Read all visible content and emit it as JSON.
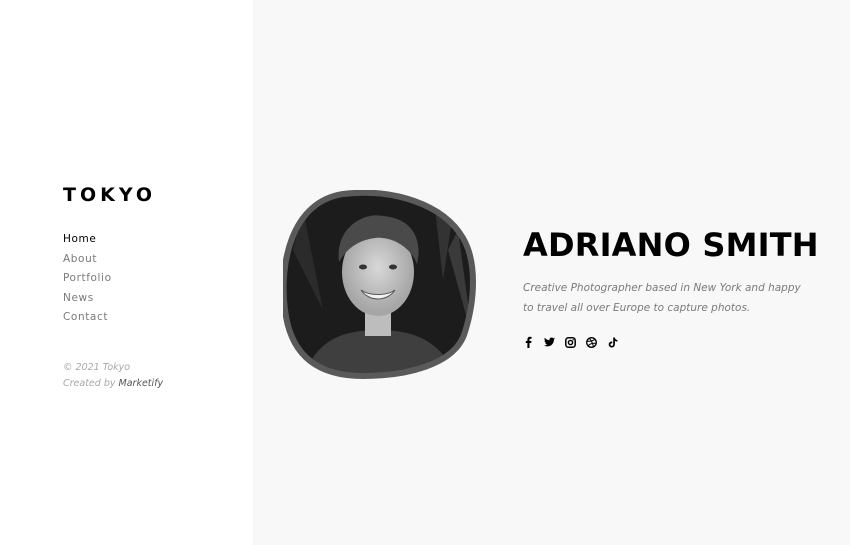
{
  "sidebar": {
    "logo": "TOKYO",
    "nav": [
      {
        "label": "Home",
        "active": true
      },
      {
        "label": "About"
      },
      {
        "label": "Portfolio"
      },
      {
        "label": "News"
      },
      {
        "label": "Contact"
      }
    ],
    "copyright": "© 2021 Tokyo",
    "created_by": "Created by",
    "brand": "Marketify"
  },
  "hero": {
    "name": "ADRIANO SMITH",
    "bio_line1": "Creative Photographer based in New York and happy",
    "bio_line2": "to travel all over Europe to capture photos.",
    "socials": [
      "facebook-icon",
      "twitter-icon",
      "instagram-icon",
      "dribbble-icon",
      "tiktok-icon"
    ]
  },
  "colors": {
    "sidebar_bg": "#ffffff",
    "main_bg": "#f8f8f8",
    "text_primary": "#000000",
    "text_muted": "#7a7a7a"
  }
}
